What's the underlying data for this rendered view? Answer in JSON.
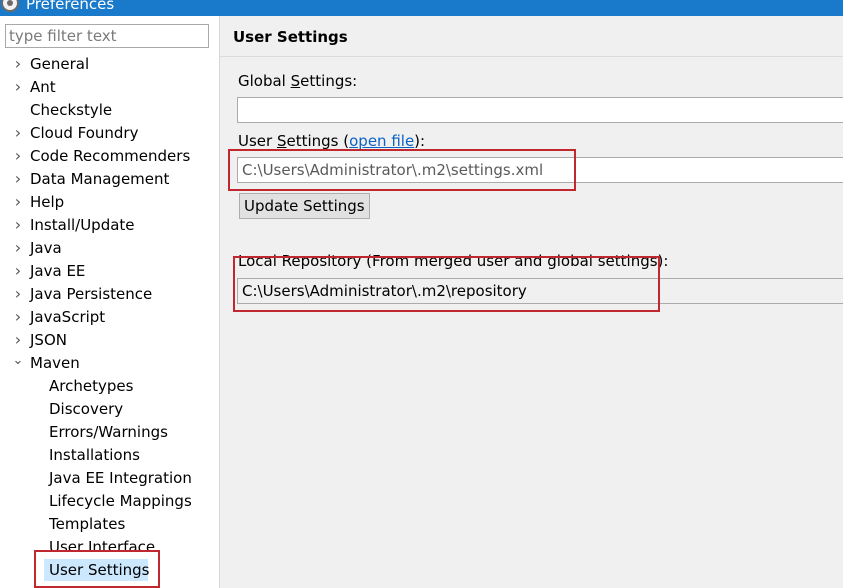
{
  "window": {
    "title": "Preferences"
  },
  "filter": {
    "placeholder": "type filter text",
    "value": ""
  },
  "tree": {
    "items": [
      {
        "label": "General",
        "expanded": false
      },
      {
        "label": "Ant",
        "expanded": false
      },
      {
        "label": "Checkstyle",
        "expanded": null
      },
      {
        "label": "Cloud Foundry",
        "expanded": false
      },
      {
        "label": "Code Recommenders",
        "expanded": false
      },
      {
        "label": "Data Management",
        "expanded": false
      },
      {
        "label": "Help",
        "expanded": false
      },
      {
        "label": "Install/Update",
        "expanded": false
      },
      {
        "label": "Java",
        "expanded": false
      },
      {
        "label": "Java EE",
        "expanded": false
      },
      {
        "label": "Java Persistence",
        "expanded": false
      },
      {
        "label": "JavaScript",
        "expanded": false
      },
      {
        "label": "JSON",
        "expanded": false
      },
      {
        "label": "Maven",
        "expanded": true
      }
    ],
    "maven_children": [
      "Archetypes",
      "Discovery",
      "Errors/Warnings",
      "Installations",
      "Java EE Integration",
      "Lifecycle Mappings",
      "Templates",
      "User Interface",
      "User Settings"
    ],
    "selected": "User Settings"
  },
  "page": {
    "title": "User Settings",
    "global_settings_label_pre": "Global ",
    "global_settings_label_u": "S",
    "global_settings_label_post": "ettings:",
    "global_settings_value": "",
    "user_settings_label_pre": "User ",
    "user_settings_label_u": "S",
    "user_settings_label_mid": "ettings (",
    "user_settings_link": "open file",
    "user_settings_label_post": "):",
    "user_settings_value": "C:\\Users\\Administrator\\.m2\\settings.xml",
    "update_button": "Update Settings",
    "local_repo_label": "Local Repository (From merged user and global settings):",
    "local_repo_value": "C:\\Users\\Administrator\\.m2\\repository"
  },
  "colors": {
    "titlebar": "#1979ca",
    "selection": "#cce8ff",
    "highlight_box": "#c0282e",
    "link": "#0b63c5"
  }
}
